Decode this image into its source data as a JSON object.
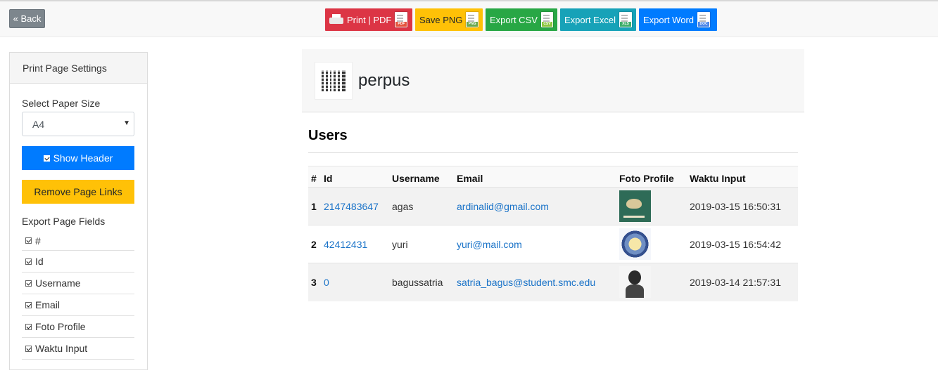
{
  "toolbar": {
    "back_label": "« Back",
    "buttons": [
      {
        "label": "Print | PDF",
        "tag": "PDF",
        "color": "#dc3545"
      },
      {
        "label": "Save PNG",
        "tag": "PNG",
        "color": "#ffc107"
      },
      {
        "label": "Export CSV",
        "tag": "CSV",
        "color": "#28a745"
      },
      {
        "label": "Export Excel",
        "tag": "XLS",
        "color": "#17a2b8"
      },
      {
        "label": "Export Word",
        "tag": "DOC",
        "color": "#007bff"
      }
    ]
  },
  "settings": {
    "title": "Print Page Settings",
    "paper_size_label": "Select Paper Size",
    "paper_size_value": "A4",
    "show_header_label": "Show Header",
    "remove_links_label": "Remove Page Links",
    "fields_label": "Export Page Fields",
    "fields": [
      "#",
      "Id",
      "Username",
      "Email",
      "Foto Profile",
      "Waktu Input"
    ]
  },
  "report": {
    "site_name": "perpus",
    "section_title": "Users",
    "columns": [
      "#",
      "Id",
      "Username",
      "Email",
      "Foto Profile",
      "Waktu Input"
    ],
    "rows": [
      {
        "num": "1",
        "id": "2147483647",
        "username": "agas",
        "email": "ardinalid@gmail.com",
        "waktu": "2019-03-15 16:50:31"
      },
      {
        "num": "2",
        "id": "42412431",
        "username": "yuri",
        "email": "yuri@mail.com",
        "waktu": "2019-03-15 16:54:42"
      },
      {
        "num": "3",
        "id": "0",
        "username": "bagussatria",
        "email": "satria_bagus@student.smc.edu",
        "waktu": "2019-03-14 21:57:31"
      }
    ]
  }
}
